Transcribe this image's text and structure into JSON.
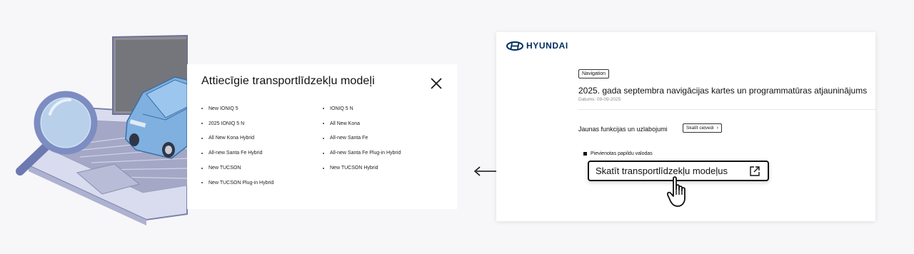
{
  "popup": {
    "title": "Attiecīgie transportlīdzekļu modeļi",
    "models": [
      "New IONIQ 5",
      "IONIQ 5 N",
      "2025 IONIQ 5 N",
      "All New Kona",
      "All New Kona Hybrid",
      "All-new Santa Fe",
      "All-new Santa Fe Hybrid",
      "All-new Santa Fe Plug-in Hybrid",
      "New TUCSON",
      "New TUCSON Hybrid",
      "New TUCSON Plug-in Hybrid"
    ]
  },
  "page": {
    "brand": "HYUNDAI",
    "category": "Navigation",
    "title": "2025. gada septembra navigācijas kartes un programmatūras atjauninājums",
    "date": "Datums: 09-09-2025",
    "features_label": "Jaunas funkcijas un uzlabojumi",
    "guide_button": "Skatīt ceļvedi",
    "language_note": "Pievienotas papildu valodas",
    "view_models_button": "Skatīt transportlīdzekļu modeļus"
  },
  "colors": {
    "brand": "#002c5f",
    "car": "#7fb0e0",
    "laptop": "#c7cbe3"
  },
  "icons": [
    "close-icon",
    "hyundai-logo-icon",
    "chevron-right-icon",
    "external-link-icon",
    "hand-cursor-icon",
    "magnifier-icon",
    "arrow-left-icon"
  ]
}
